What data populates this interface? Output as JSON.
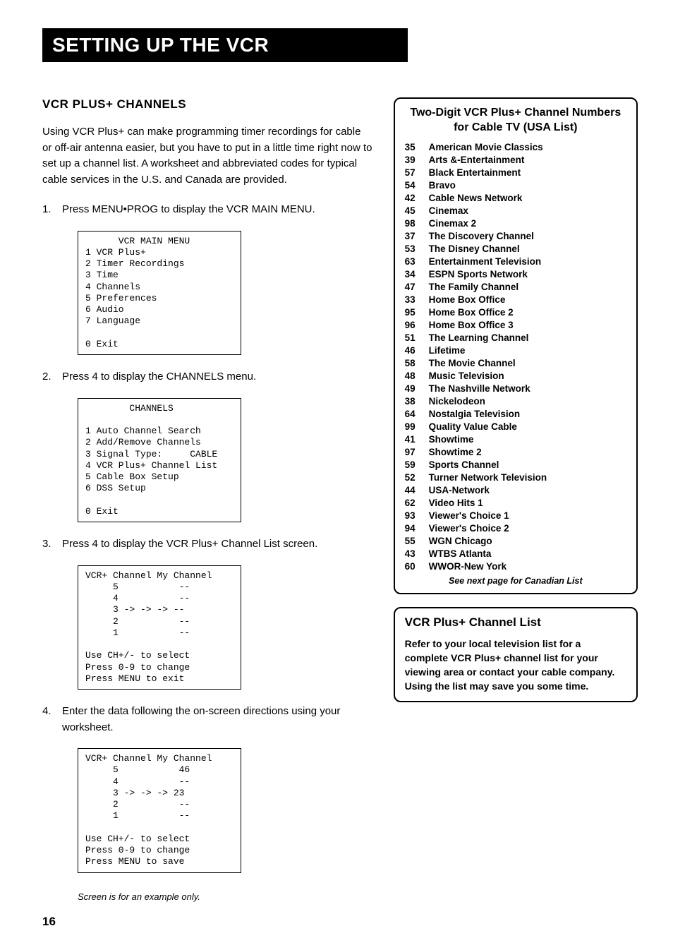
{
  "banner": "SETTING UP THE VCR",
  "section_title": "VCR PLUS+ CHANNELS",
  "intro": "Using VCR Plus+ can make programming timer recordings for cable or off-air antenna easier, but you have to put in a little time right now to set up a channel list. A worksheet and abbreviated codes for typical cable services in the U.S. and Canada are provided.",
  "steps": {
    "s1": "Press MENU•PROG to display the VCR MAIN MENU.",
    "s2": "Press 4 to display the CHANNELS menu.",
    "s3": "Press 4 to display the VCR Plus+ Channel List screen.",
    "s4": "Enter the data following the on-screen directions using your worksheet."
  },
  "screens": {
    "main_menu": "      VCR MAIN MENU\n1 VCR Plus+\n2 Timer Recordings\n3 Time\n4 Channels\n5 Preferences\n6 Audio\n7 Language\n\n0 Exit",
    "channels": "        CHANNELS\n\n1 Auto Channel Search\n2 Add/Remove Channels\n3 Signal Type:     CABLE\n4 VCR Plus+ Channel List\n5 Cable Box Setup\n6 DSS Setup\n\n0 Exit",
    "vcrlist1": "VCR+ Channel My Channel\n     5           --\n     4           --\n     3 -> -> -> --\n     2           --\n     1           --\n\nUse CH+/- to select\nPress 0-9 to change\nPress MENU to exit",
    "vcrlist2": "VCR+ Channel My Channel\n     5           46\n     4           --\n     3 -> -> -> 23\n     2           --\n     1           --\n\nUse CH+/- to select\nPress 0-9 to change\nPress MENU to save"
  },
  "footnote": "Screen is for an example only.",
  "pagenum": "16",
  "usa_title": "Two-Digit VCR Plus+ Channel Numbers for Cable TV (USA List)",
  "usa_list": [
    {
      "n": "35",
      "t": "American Movie Classics"
    },
    {
      "n": "39",
      "t": "Arts &-Entertainment"
    },
    {
      "n": "57",
      "t": "Black Entertainment"
    },
    {
      "n": "54",
      "t": "Bravo"
    },
    {
      "n": "42",
      "t": "Cable News Network"
    },
    {
      "n": "45",
      "t": "Cinemax"
    },
    {
      "n": "98",
      "t": "Cinemax 2"
    },
    {
      "n": "37",
      "t": "The Discovery Channel"
    },
    {
      "n": "53",
      "t": "The Disney Channel"
    },
    {
      "n": "63",
      "t": "Entertainment Television"
    },
    {
      "n": "34",
      "t": "ESPN Sports Network"
    },
    {
      "n": "47",
      "t": "The Family Channel"
    },
    {
      "n": "33",
      "t": "Home Box Office"
    },
    {
      "n": "95",
      "t": "Home Box Office 2"
    },
    {
      "n": "96",
      "t": "Home Box Office 3"
    },
    {
      "n": "51",
      "t": "The Learning Channel"
    },
    {
      "n": "46",
      "t": "Lifetime"
    },
    {
      "n": "58",
      "t": "The Movie Channel"
    },
    {
      "n": "48",
      "t": "Music Television"
    },
    {
      "n": "49",
      "t": "The Nashville Network"
    },
    {
      "n": "38",
      "t": "Nickelodeon"
    },
    {
      "n": "64",
      "t": "Nostalgia Television"
    },
    {
      "n": "99",
      "t": "Quality Value Cable"
    },
    {
      "n": "41",
      "t": "Showtime"
    },
    {
      "n": "97",
      "t": "Showtime 2"
    },
    {
      "n": "59",
      "t": "Sports Channel"
    },
    {
      "n": "52",
      "t": "Turner Network Television"
    },
    {
      "n": "44",
      "t": "USA-Network"
    },
    {
      "n": "62",
      "t": "Video Hits 1"
    },
    {
      "n": "93",
      "t": "Viewer's Choice 1"
    },
    {
      "n": "94",
      "t": "Viewer's Choice 2"
    },
    {
      "n": "55",
      "t": "WGN Chicago"
    },
    {
      "n": "43",
      "t": "WTBS Atlanta"
    },
    {
      "n": "60",
      "t": "WWOR-New York"
    }
  ],
  "seenext": "See next page for Canadian List",
  "box2_title": "VCR Plus+ Channel List",
  "box2_body": "Refer to your local television list for a complete VCR Plus+ channel list for your viewing area or contact your cable company. Using the list may save you some time."
}
